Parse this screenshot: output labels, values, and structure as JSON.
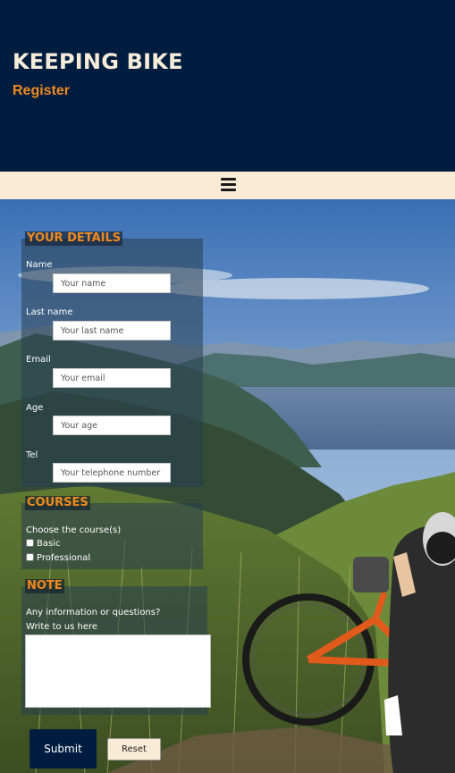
{
  "header": {
    "title": "KEEPING BIKE",
    "subtitle": "Register"
  },
  "nav": {
    "menu_icon": "hamburger-menu-icon"
  },
  "form": {
    "details": {
      "legend": "YOUR DETAILS",
      "name_label": "Name",
      "name_placeholder": "Your name",
      "lastname_label": "Last name",
      "lastname_placeholder": "Your last name",
      "email_label": "Email",
      "email_placeholder": "Your email",
      "age_label": "Age",
      "age_placeholder": "Your age",
      "tel_label": "Tel",
      "tel_placeholder": "Your telephone number"
    },
    "courses": {
      "legend": "COURSES",
      "prompt": "Choose the course(s)",
      "options": [
        {
          "label": "Basic",
          "checked": false
        },
        {
          "label": "Professional",
          "checked": false
        }
      ]
    },
    "note": {
      "legend": "NOTE",
      "prompt_line1": "Any information or questions?",
      "prompt_line2": "Write to us here",
      "value": ""
    },
    "submit_label": "Submit",
    "reset_label": "Reset"
  },
  "colors": {
    "header_bg": "#001d3f",
    "nav_bg": "#faebd7",
    "accent": "#f08a1f",
    "title_text": "#f5ecd9"
  }
}
